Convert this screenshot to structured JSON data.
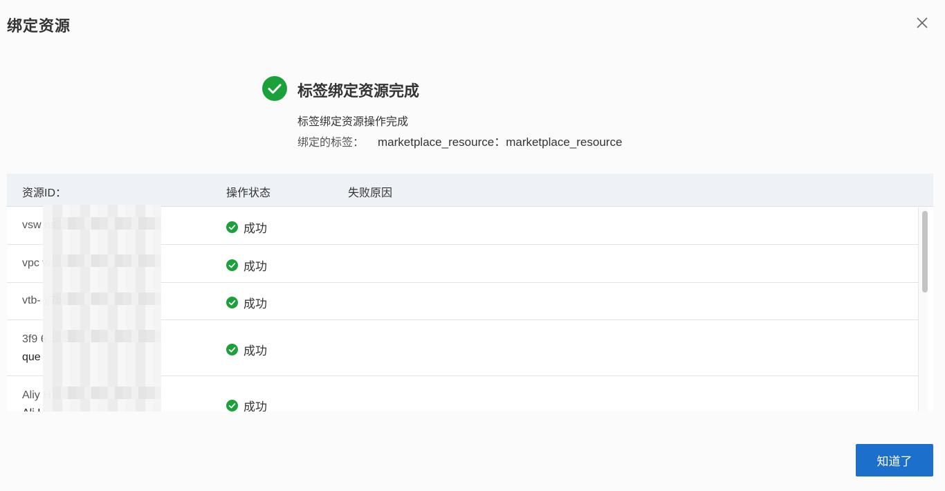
{
  "dialog": {
    "title": "绑定资源",
    "close_icon": "close-icon",
    "confirm_label": "知道了"
  },
  "result": {
    "icon": "check-circle-icon",
    "title": "标签绑定资源完成",
    "subtitle": "标签绑定资源操作完成",
    "tags_label": "绑定的标签：",
    "tags_value": "marketplace_resource：marketplace_resource"
  },
  "table": {
    "columns": [
      "资源ID：",
      "操作状态",
      "失败原因"
    ],
    "rows": [
      {
        "id_line1": "vsw                              ns…",
        "id_line2": "",
        "status": "成功",
        "reason": ""
      },
      {
        "id_line1": "vpc                              w…",
        "id_line2": "",
        "status": "成功",
        "reason": ""
      },
      {
        "id_line1": "vtb-                             )j7b",
        "id_line2": "",
        "status": "成功",
        "reason": ""
      },
      {
        "id_line1": "3f9                              6…",
        "id_line2": "que",
        "status": "成功",
        "reason": ""
      },
      {
        "id_line1": "Aliy                             H",
        "id_line2": "Ali                              H",
        "status": "成功",
        "reason": ""
      }
    ]
  },
  "colors": {
    "success": "#1aa13a",
    "primary": "#1d6fcc",
    "header_bg": "#eef1f5"
  }
}
